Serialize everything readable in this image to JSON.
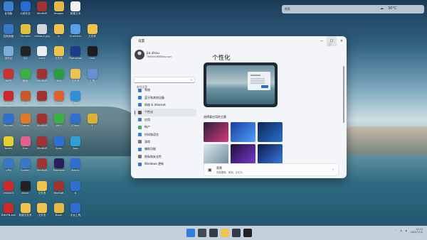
{
  "desktop": {
    "icons": [
      {
        "label": "此电脑",
        "color": "#3c7fd0"
      },
      {
        "label": "火绒安全",
        "color": "#2a6bd1"
      },
      {
        "label": "WinRAR",
        "color": "#a03232"
      },
      {
        "label": "Images",
        "color": "#e6b84a"
      },
      {
        "label": "新建文本",
        "color": "#f2f2f2"
      },
      {
        "label": "控制面板",
        "color": "#3a78c6"
      },
      {
        "label": "Chrome",
        "color": "#e2c13a"
      },
      {
        "label": "network.jpg",
        "color": "#cfd6de"
      },
      {
        "label": "b",
        "color": "#f0c250"
      },
      {
        "label": "OneDrive",
        "color": "#5aa0e6"
      },
      {
        "label": "文件夹",
        "color": "#f0c250"
      },
      {
        "label": "回收站",
        "color": "#7ab0d8"
      },
      {
        "label": "QQ",
        "color": "#222222"
      },
      {
        "label": "note",
        "color": "#e9eef4"
      },
      {
        "label": "文件夹",
        "color": "#f0c250"
      },
      {
        "label": "Photoshop",
        "color": "#1f3a8c"
      },
      {
        "label": "cmd",
        "color": "#1d1d1d"
      },
      {
        "label": "WPS",
        "color": "#c83232"
      },
      {
        "label": "微信",
        "color": "#3cb043"
      },
      {
        "label": "WinRAR",
        "color": "#a03232"
      },
      {
        "label": "360",
        "color": "#2a9d3c"
      },
      {
        "label": "文件夹",
        "color": "#f0c250"
      },
      {
        "label": "工具",
        "color": "#6a8fd0"
      },
      {
        "label": "Bandizip",
        "color": "#cc2a2a"
      },
      {
        "label": "RAR",
        "color": "#c85a2a"
      },
      {
        "label": "WinRAR",
        "color": "#a03232"
      },
      {
        "label": "Office",
        "color": "#e06030"
      },
      {
        "label": "Edge",
        "color": "#2f8fd8"
      },
      {
        "label": "Rocket",
        "color": "#2f6fd0"
      },
      {
        "label": "Game",
        "color": "#e07a2a"
      },
      {
        "label": "WinRAR",
        "color": "#a03232"
      },
      {
        "label": "WiFi",
        "color": "#3cb043"
      },
      {
        "label": "Clash",
        "color": "#2f6fd0"
      },
      {
        "label": "Y",
        "color": "#d8b230"
      },
      {
        "label": "Notes",
        "color": "#e6d030"
      },
      {
        "label": "Edu",
        "color": "#e06090"
      },
      {
        "label": "WinRAR",
        "color": "#a03232"
      },
      {
        "label": "Apps",
        "color": "#2f6fd0"
      },
      {
        "label": "App",
        "color": "#2f9fd8"
      },
      {
        "label": "VPN",
        "color": "#3a78c6"
      },
      {
        "label": "Screen",
        "color": "#3a78c6"
      },
      {
        "label": "WinRAR",
        "color": "#a03232"
      },
      {
        "label": "Premiere",
        "color": "#2a1e5c"
      },
      {
        "label": "Baidu",
        "color": "#2f6fd0"
      },
      {
        "label": "VSWATS",
        "color": "#cc2a2a"
      },
      {
        "label": "driver",
        "color": "#222222"
      },
      {
        "label": "文件夹",
        "color": "#f0c250"
      },
      {
        "label": "WinRAR",
        "color": "#a03232"
      },
      {
        "label": "K",
        "color": "#2f6fd0"
      },
      {
        "label": "BitVPN.exe",
        "color": "#cc2a2a"
      },
      {
        "label": "新建文件夹",
        "color": "#f0c250"
      },
      {
        "label": "文件夹",
        "color": "#f0c250"
      },
      {
        "label": "Book",
        "color": "#e6b84a"
      },
      {
        "label": "平台工具",
        "color": "#2f6fd0"
      }
    ]
  },
  "widget": {
    "search_hint": "搜索",
    "weather": "30°C"
  },
  "window": {
    "title": "设置",
    "user": {
      "name": "jia zhou",
      "email": "764640388@qq.com"
    },
    "search_placeholder": "查找设置",
    "nav": [
      {
        "label": "系统",
        "color": "#2f77d0"
      },
      {
        "label": "蓝牙和其他设备",
        "color": "#2f77d0"
      },
      {
        "label": "网络 & Internet",
        "color": "#2f77d0"
      },
      {
        "label": "个性化",
        "color": "#555555",
        "selected": true
      },
      {
        "label": "应用",
        "color": "#3a7fd0"
      },
      {
        "label": "帐户",
        "color": "#3cb06a"
      },
      {
        "label": "时间和语言",
        "color": "#3a7fd0"
      },
      {
        "label": "游戏",
        "color": "#777777"
      },
      {
        "label": "辅助功能",
        "color": "#3a7fd0"
      },
      {
        "label": "隐私和安全性",
        "color": "#777777"
      },
      {
        "label": "Windows 更新",
        "color": "#2f77d0"
      }
    ],
    "page_title": "个性化",
    "theme_label": "选择要应用的主题",
    "themes": [
      {
        "c1": "#2a1f3d",
        "c2": "#d63a78"
      },
      {
        "c1": "#1a3f9c",
        "c2": "#4fa0ff"
      },
      {
        "c1": "#0f2650",
        "c2": "#2a6fd0"
      },
      {
        "c1": "#dfe7ec",
        "c2": "#6d8f9f"
      },
      {
        "c1": "#1c0f3a",
        "c2": "#7a3ad0"
      },
      {
        "c1": "#0b1a4a",
        "c2": "#3a7ae0"
      }
    ],
    "appearance": {
      "title": "背景",
      "subtitle": "背景图像、颜色、幻灯片"
    }
  },
  "taskbar": {
    "apps": [
      {
        "name": "start-icon",
        "color": "#2f7fe0"
      },
      {
        "name": "search-icon",
        "color": "#404a57"
      },
      {
        "name": "explorer-icon",
        "color": "#333b48"
      },
      {
        "name": "edge-icon",
        "color": "#f0c250"
      },
      {
        "name": "store-icon",
        "color": "#333b48"
      },
      {
        "name": "settings-icon",
        "color": "#222222"
      }
    ],
    "time": "15:12",
    "date": "2022/11/2"
  }
}
